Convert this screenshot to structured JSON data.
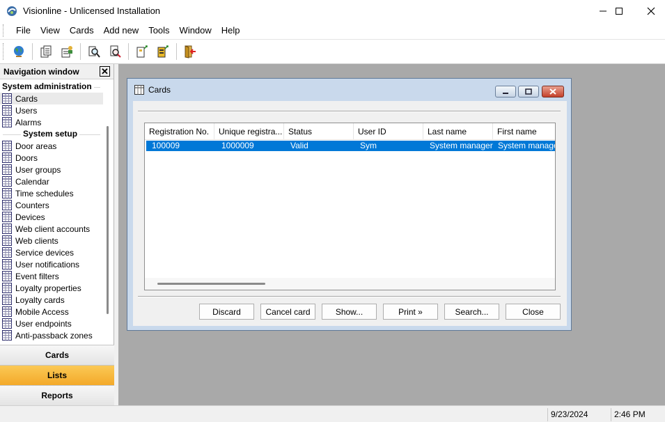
{
  "window": {
    "title": "Visionline - Unlicensed Installation",
    "controls": [
      "minimize",
      "maximize",
      "close"
    ]
  },
  "menu": [
    "File",
    "View",
    "Cards",
    "Add new",
    "Tools",
    "Window",
    "Help"
  ],
  "toolbar": {
    "icons": [
      "globe-icon",
      "document-icon",
      "user-document-icon",
      "search-key-icon",
      "search-card-icon",
      "new-card-icon",
      "encode-card-icon",
      "exit-door-icon"
    ]
  },
  "navigation": {
    "title": "Navigation window",
    "section1": "System administration",
    "admin_items": [
      "Cards",
      "Users",
      "Alarms"
    ],
    "section2": "System setup",
    "setup_items": [
      "Door areas",
      "Doors",
      "User groups",
      "Calendar",
      "Time schedules",
      "Counters",
      "Devices",
      "Web client accounts",
      "Web clients",
      "Service devices",
      "User notifications",
      "Event filters",
      "Loyalty properties",
      "Loyalty cards",
      "Mobile Access",
      "User endpoints",
      "Anti-passback zones"
    ],
    "buttons": [
      "Cards",
      "Lists",
      "Reports"
    ],
    "active_button": "Lists"
  },
  "dialog": {
    "title": "Cards",
    "columns": [
      "Registration No.",
      "Unique registra...",
      "Status",
      "User ID",
      "Last name",
      "First name"
    ],
    "rows": [
      [
        "100009",
        "1000009",
        "Valid",
        "Sym",
        "System manager",
        "System manager"
      ]
    ],
    "buttons": [
      "Discard",
      "Cancel card",
      "Show...",
      "Print »",
      "Search...",
      "Close"
    ]
  },
  "status": {
    "date": "9/23/2024",
    "time": "2:46 PM"
  },
  "colors": {
    "selection": "#0078d7",
    "active_nav_button": "#f3a92a",
    "mdi_background": "#a9a9a9",
    "dialog_frame": "#c9d9ec"
  }
}
